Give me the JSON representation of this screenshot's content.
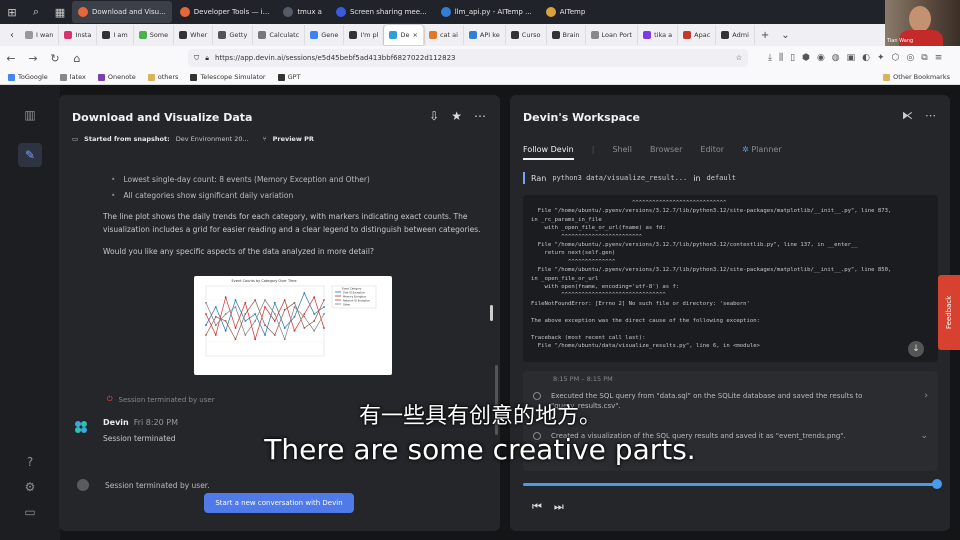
{
  "os_taskbar": {
    "windows": [
      {
        "label": "Download and Visu...",
        "color": "#e8663c",
        "active": true
      },
      {
        "label": "Developer Tools — i...",
        "color": "#e8663c",
        "active": false
      },
      {
        "label": "tmux a",
        "color": "#555b66",
        "active": false
      },
      {
        "label": "Screen sharing mee...",
        "color": "#3a5be0",
        "active": false
      },
      {
        "label": "llm_api.py - AITemp ...",
        "color": "#2f7fd6",
        "active": false
      },
      {
        "label": "AITemp",
        "color": "#d9a33a",
        "active": false
      }
    ]
  },
  "webcam": {
    "name_tag": "Tian Wang"
  },
  "browser_tabs": [
    {
      "label": "I wan",
      "color": "#999"
    },
    {
      "label": "Insta",
      "color": "#d6336c"
    },
    {
      "label": "I am ",
      "color": "#333"
    },
    {
      "label": "Some",
      "color": "#4caf50"
    },
    {
      "label": "Wher",
      "color": "#333"
    },
    {
      "label": "Getty",
      "color": "#555"
    },
    {
      "label": "Calculatc",
      "color": "#777"
    },
    {
      "label": "Gene",
      "color": "#3b82f6"
    },
    {
      "label": "I'm pl",
      "color": "#333"
    },
    {
      "label": "De",
      "color": "#2f9fd6",
      "active": true
    },
    {
      "label": "cat ai",
      "color": "#e0792a"
    },
    {
      "label": "API ke",
      "color": "#2f7fd6"
    },
    {
      "label": "Curso",
      "color": "#333"
    },
    {
      "label": "Brain",
      "color": "#333"
    },
    {
      "label": "Loan Port",
      "color": "#888"
    },
    {
      "label": "tika a",
      "color": "#7c3aed"
    },
    {
      "label": "Apac",
      "color": "#c0392b"
    },
    {
      "label": "Admi",
      "color": "#333"
    }
  ],
  "address": {
    "url": "https://app.devin.ai/sessions/e5d45bebf5ad413bbf6827022d112823"
  },
  "bookmarks": {
    "items": [
      {
        "label": "ToGoogle",
        "color": "#4285f4"
      },
      {
        "label": "latex",
        "color": "#888"
      },
      {
        "label": "Onenote",
        "color": "#7b3fb0"
      },
      {
        "label": "others",
        "color": "#d8b45a"
      },
      {
        "label": "Telescope Simulator",
        "color": "#333"
      },
      {
        "label": "GPT",
        "color": "#333"
      }
    ],
    "other": "Other Bookmarks"
  },
  "chat": {
    "title": "Download and Visualize Data",
    "snapshot_label": "Started from snapshot:",
    "snapshot_value": "Dev Environment 20...",
    "preview_pr": "Preview PR",
    "bullets": [
      "Lowest single-day count: 8 events (Memory Exception and Other)",
      "All categories show significant daily variation"
    ],
    "para1": "The line plot shows the daily trends for each category, with markers indicating exact counts. The visualization includes a grid for easier reading and a clear legend to distinguish between categories.",
    "para2": "Would you like any specific aspects of the data analyzed in more detail?",
    "session_terminated": "Session terminated by user",
    "devin_name": "Devin",
    "devin_time": "Fri 8:20 PM",
    "devin_text": "Session terminated",
    "system_text": "Session terminated by user.",
    "start_button": "Start a new conversation with Devin"
  },
  "workspace": {
    "title": "Devin's Workspace",
    "tabs": [
      "Follow Devin",
      "Shell",
      "Browser",
      "Editor",
      "Planner"
    ],
    "run_label": "Ran",
    "run_command": "python3 data/visualize_result...",
    "run_in": "in",
    "run_dir": "default",
    "terminal": "                              ^^^^^^^^^^^^^^^^^^^^^^^^^^^^\n  File \"/home/ubuntu/.pyenv/versions/3.12.7/lib/python3.12/site-packages/matplotlib/__init__.py\", line 873,\nin _rc_params_in_file\n    with _open_file_or_url(fname) as fd:\n         ^^^^^^^^^^^^^^^^^^^^^^^^\n  File \"/home/ubuntu/.pyenv/versions/3.12.7/lib/python3.12/contextlib.py\", line 137, in __enter__\n    return next(self.gen)\n           ^^^^^^^^^^^^^^\n  File \"/home/ubuntu/.pyenv/versions/3.12.7/lib/python3.12/site-packages/matplotlib/__init__.py\", line 850,\nin _open_file_or_url\n    with open(fname, encoding='utf-8') as f:\n         ^^^^^^^^^^^^^^^^^^^^^^^^^^^^^^^\nFileNotFoundError: [Errno 2] No such file or directory: 'seaborn'\n\nThe above exception was the direct cause of the following exception:\n\nTraceback (most recent call last):\n  File \"/home/ubuntu/data/visualize_results.py\", line 6, in <module>",
    "planner_time": "8:15 PM – 8:15 PM",
    "steps": [
      "Executed the SQL query from \"data.sql\" on the SQLite database and saved the results to \"query_results.csv\".",
      "Created a visualization of the SQL query results and saved it as \"event_trends.png\"."
    ],
    "feedback": "Feedback"
  },
  "captions": {
    "zh": "有一些具有创意的地方。",
    "en": "There are some creative parts."
  },
  "thumbnail": {
    "title": "Event Counts by Category Over Time",
    "legend": [
      "Event Category",
      "Disk IO Exception",
      "Memory Exception",
      "Network IO Exception",
      "Other"
    ],
    "colors": [
      "#1f77b4",
      "#d62728",
      "#8c564b",
      "#7f7f7f"
    ],
    "series": [
      [
        22,
        35,
        18,
        40,
        25,
        30,
        15,
        38,
        20,
        28,
        45,
        30,
        35
      ],
      [
        30,
        15,
        42,
        20,
        38,
        12,
        35,
        25,
        40,
        18,
        30,
        42,
        20
      ],
      [
        15,
        28,
        25,
        12,
        30,
        40,
        22,
        15,
        33,
        38,
        20,
        25,
        40
      ],
      [
        38,
        22,
        30,
        35,
        15,
        25,
        40,
        30,
        12,
        35,
        28,
        18,
        30
      ]
    ]
  }
}
